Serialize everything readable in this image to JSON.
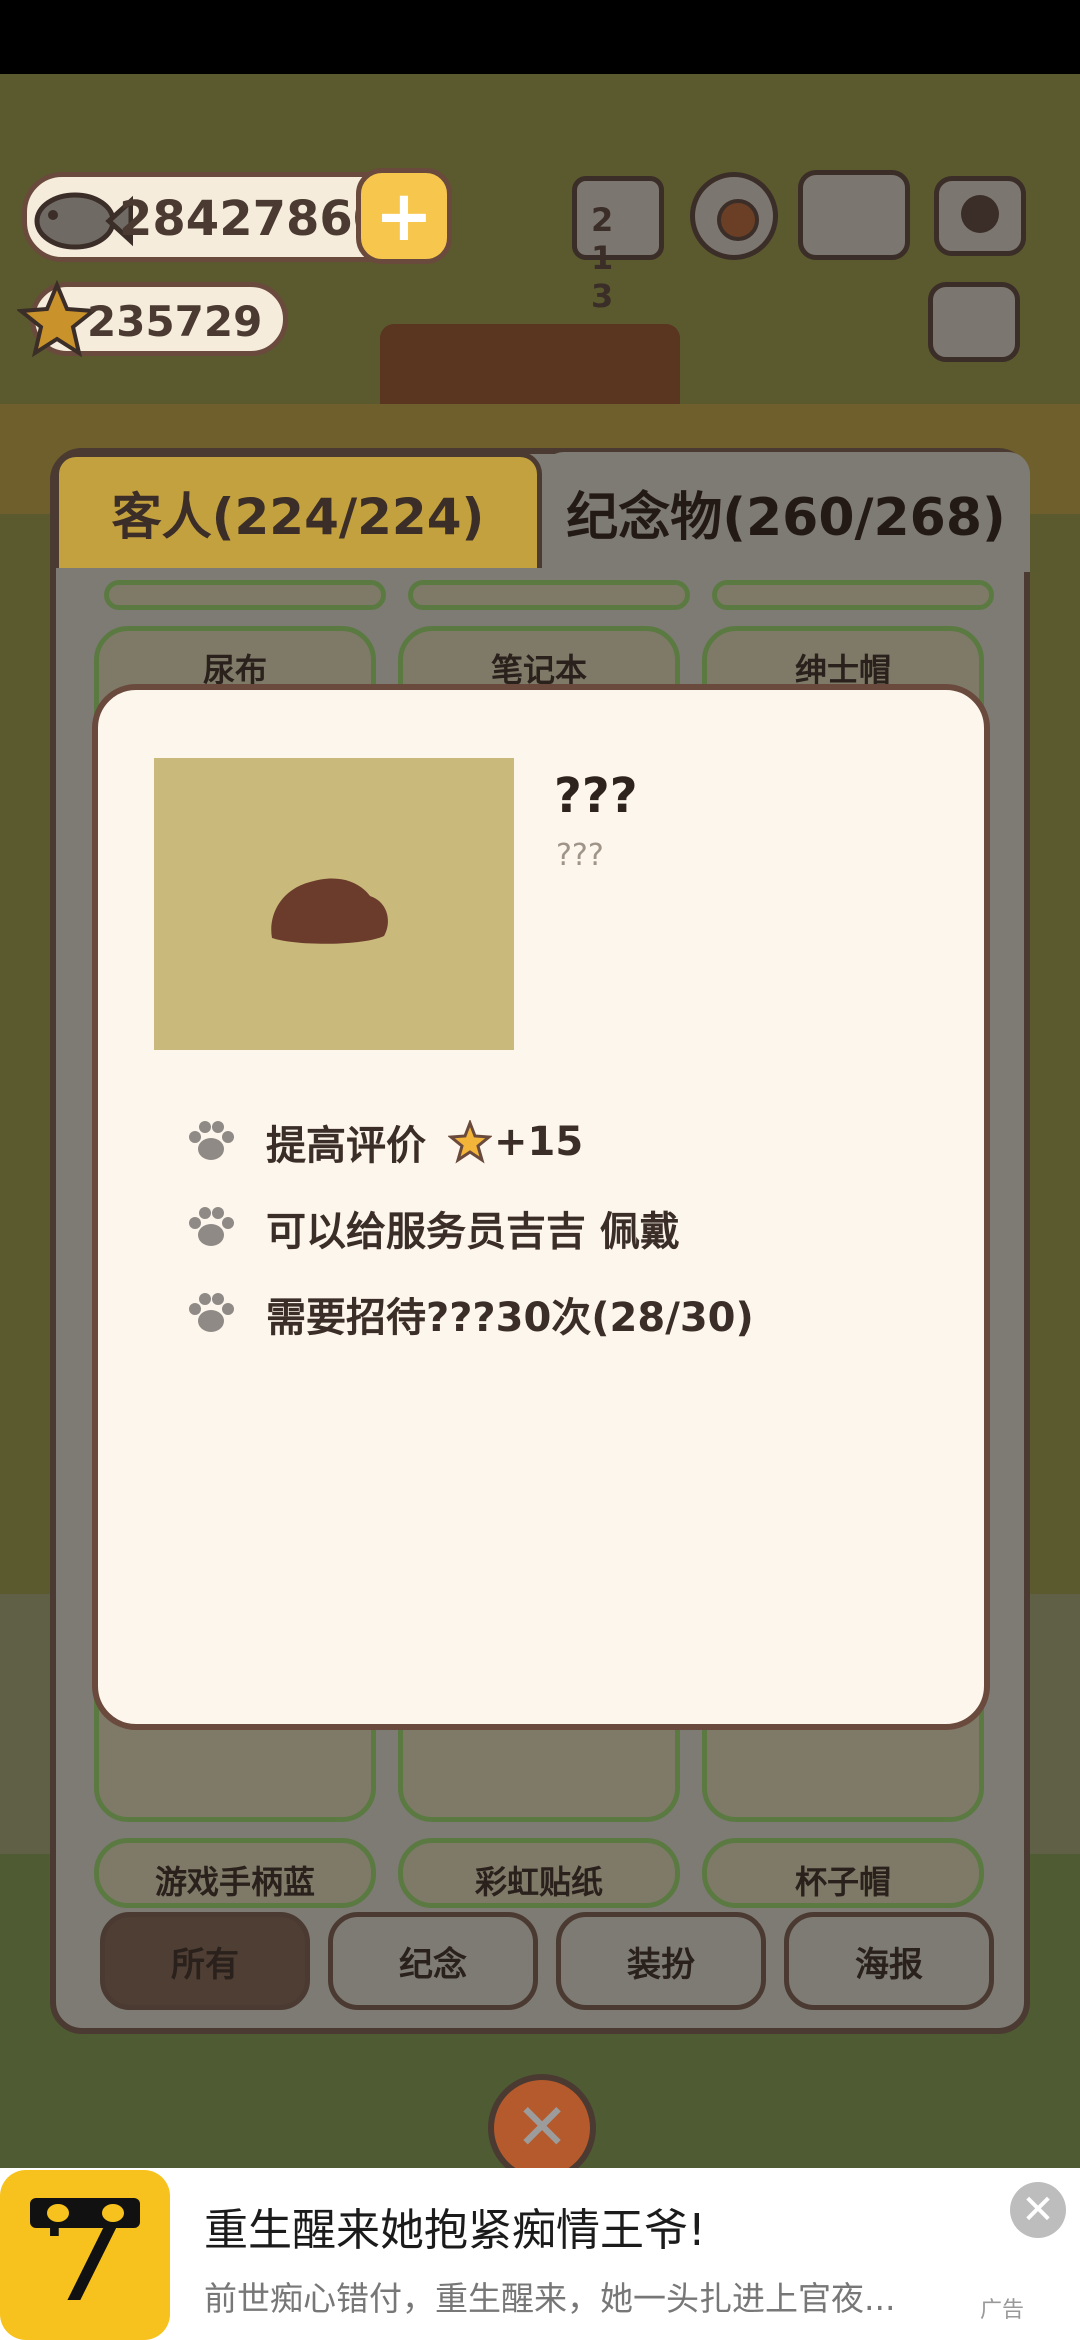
{
  "hud": {
    "fish_count": "28427860",
    "star_count": "235729",
    "rank_label": "2 1 3"
  },
  "tabs": {
    "guests": "客人(224/224)",
    "souvenirs": "纪念物(260/268)"
  },
  "grid": {
    "row_top": [
      "尿布",
      "笔记本",
      "绅士帽"
    ],
    "row_bottom": [
      "游戏手柄蓝",
      "彩虹贴纸",
      "杯子帽"
    ]
  },
  "filters": [
    "所有",
    "纪念",
    "装扮",
    "海报"
  ],
  "detail": {
    "name": "???",
    "subtitle": "???",
    "line1_text": "提高评价",
    "line1_value": "+15",
    "line2_text": "可以给服务员吉吉 佩戴",
    "line3_text": "需要招待???30次(28/30)"
  },
  "close_label": "✕",
  "ad": {
    "title": "重生醒来她抱紧痴情王爷!",
    "description": "前世痴心错付，重生醒来，她一头扎进上官夜...",
    "tag": "广告",
    "close_label": "✕"
  },
  "colors": {
    "accent_tab": "#c3a13e",
    "popup_bg": "#fcf6ec",
    "border": "#6a4a3c",
    "close_button": "#b55a2c",
    "plus_button": "#f6c64d",
    "ad_logo": "#f7c21d"
  },
  "icons": {
    "fish": "fish-icon",
    "star": "star-icon",
    "plus": "plus-icon",
    "rank": "podium-icon",
    "settings": "gear-icon",
    "book": "book-icon",
    "camera": "camera-icon",
    "news": "newspaper-icon",
    "paw": "paw-icon",
    "close": "close-icon"
  }
}
